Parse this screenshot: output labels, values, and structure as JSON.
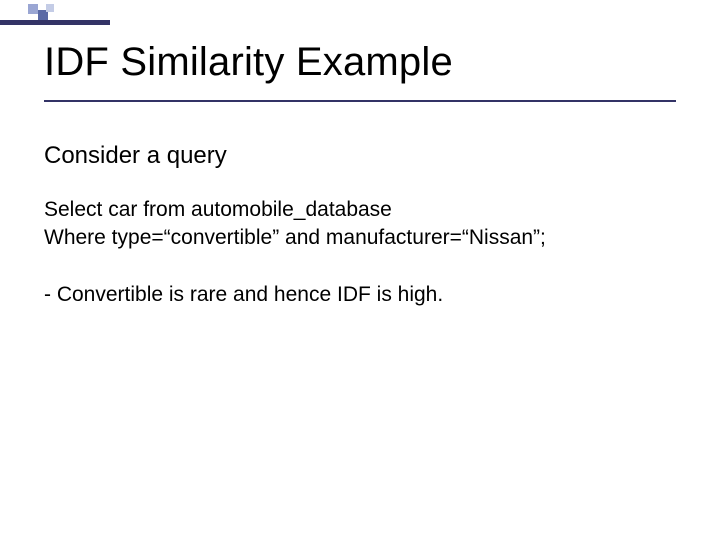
{
  "slide": {
    "title": "IDF Similarity Example",
    "lead": "Consider a query",
    "query_line1": "Select car from automobile_database",
    "query_line2": "Where type=“convertible” and manufacturer=“Nissan”;",
    "note": "- Convertible is rare and hence IDF is high."
  }
}
